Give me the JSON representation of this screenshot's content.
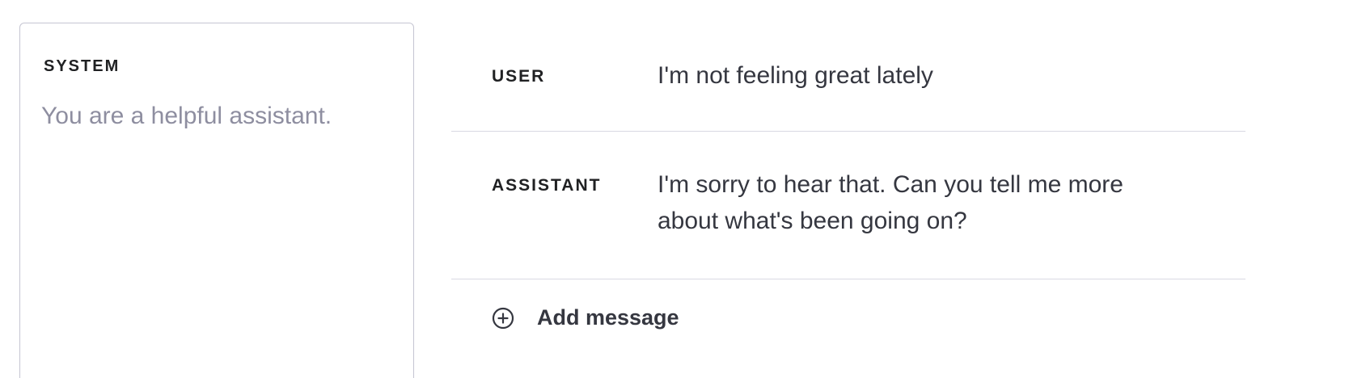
{
  "system": {
    "label": "SYSTEM",
    "placeholder": "You are a helpful assistant."
  },
  "messages": [
    {
      "role": "USER",
      "content": "I'm not feeling great lately"
    },
    {
      "role": "ASSISTANT",
      "content": "I'm sorry to hear that. Can you tell me more about what's been going on?"
    }
  ],
  "add_message": {
    "label": "Add message",
    "icon": "plus-circle-icon"
  }
}
